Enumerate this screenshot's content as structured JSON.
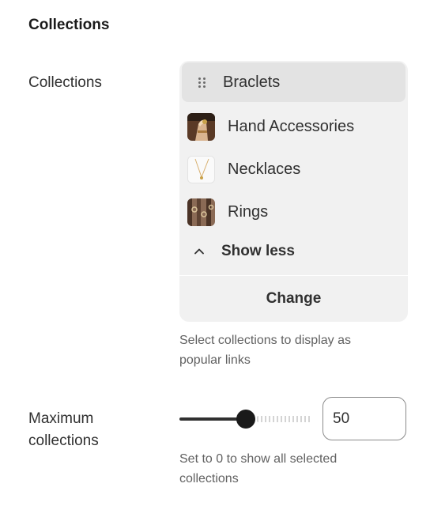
{
  "section": {
    "title": "Collections"
  },
  "collections_field": {
    "label": "Collections",
    "items": [
      {
        "label": "Braclets",
        "icon": "drag-handle-icon",
        "selected": true
      },
      {
        "label": "Hand Accessories",
        "icon": "hand-accessories-thumbnail"
      },
      {
        "label": "Necklaces",
        "icon": "necklaces-thumbnail"
      },
      {
        "label": "Rings",
        "icon": "rings-thumbnail"
      }
    ],
    "show_less_label": "Show less",
    "change_label": "Change",
    "help_line1": "Select collections to display as",
    "help_line2": "popular links"
  },
  "max_field": {
    "label_line1": "Maximum",
    "label_line2": "collections",
    "value": "50",
    "slider_fraction": 0.5,
    "help_line1": "Set to 0 to show all selected",
    "help_line2": "collections"
  },
  "colors": {
    "accent": "#303030",
    "picker_bg": "#f1f1f1",
    "selected_bg": "#e3e3e3"
  }
}
